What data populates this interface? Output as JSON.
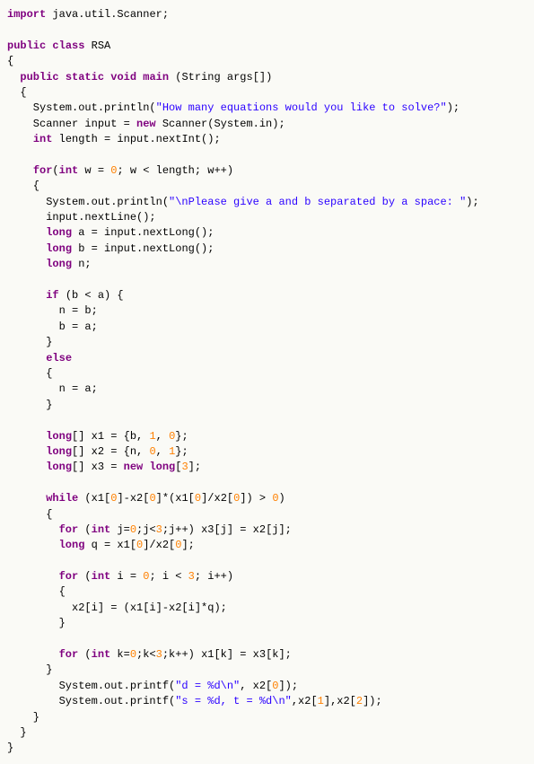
{
  "tok": {
    "import": "import",
    "public": "public",
    "class": "class",
    "RSA": "RSA",
    "static": "static",
    "void": "void",
    "main": "main",
    "String": "String",
    "args": "args",
    "System": "System",
    "out": "out",
    "println": "println",
    "str1": "\"How many equations would you like to solve?\"",
    "Scanner": "Scanner",
    "input": "input",
    "new": "new",
    "in": "in",
    "int": "int",
    "length": "length",
    "nextInt": "nextInt",
    "for": "for",
    "w": "w",
    "zero": "0",
    "one": "1",
    "three": "3",
    "str2": "\"\\nPlease give a and b separated by a space: \"",
    "nextLine": "nextLine",
    "long": "long",
    "a": "a",
    "b": "b",
    "n": "n",
    "nextLong": "nextLong",
    "if": "if",
    "else": "else",
    "x1": "x1",
    "x2": "x2",
    "x3": "x3",
    "while": "while",
    "j": "j",
    "q": "q",
    "i": "i",
    "k": "k",
    "printf": "printf",
    "str3": "\"d = %d\\n\"",
    "str4": "\"s = %d, t = %d\\n\"",
    "two": "2",
    "javautil": " java.util.Scanner;"
  }
}
